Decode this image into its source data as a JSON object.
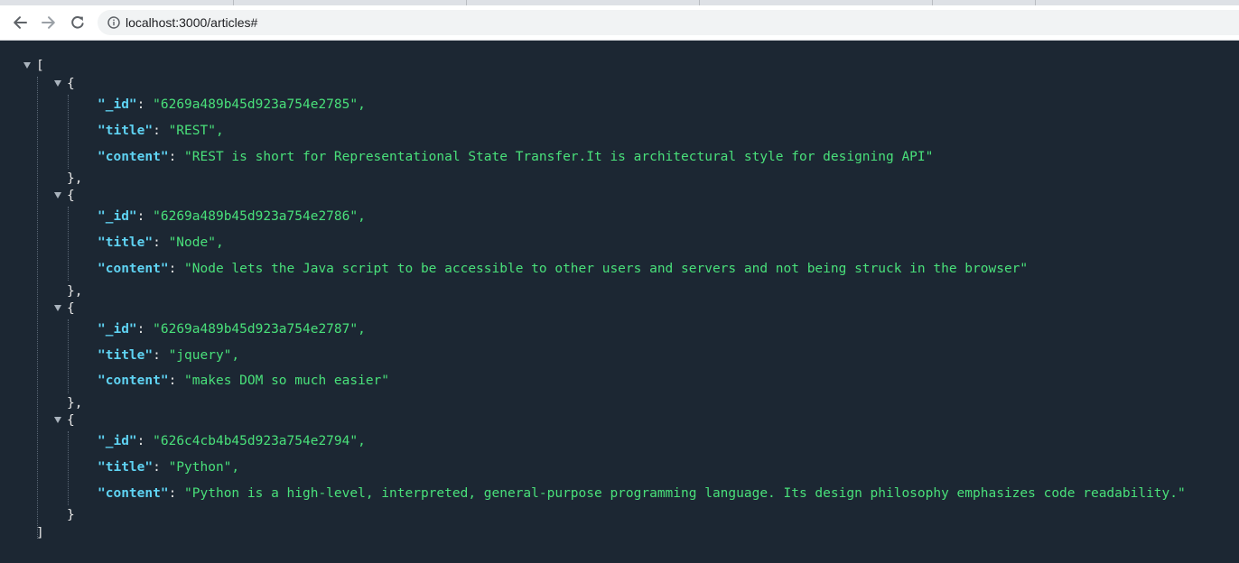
{
  "browser": {
    "url": "localhost:3000/articles#",
    "icons": {
      "back": "arrow-left-icon",
      "forward": "arrow-right-icon",
      "reload": "reload-icon",
      "info": "info-circle-icon"
    }
  },
  "json": {
    "open_bracket": "[",
    "close_bracket": "]",
    "open_brace": "{",
    "close_brace": "}",
    "close_brace_comma": "},",
    "articles": [
      {
        "id_key": "\"_id\"",
        "id": "\"6269a489b45d923a754e2785\",",
        "title_key": "\"title\"",
        "title": "\"REST\",",
        "content_key": "\"content\"",
        "content": "\"REST is short for Representational State Transfer.It is architectural style for designing API\""
      },
      {
        "id_key": "\"_id\"",
        "id": "\"6269a489b45d923a754e2786\",",
        "title_key": "\"title\"",
        "title": "\"Node\",",
        "content_key": "\"content\"",
        "content": "\"Node lets the Java script to be accessible to other users and servers and not being struck in the browser\""
      },
      {
        "id_key": "\"_id\"",
        "id": "\"6269a489b45d923a754e2787\",",
        "title_key": "\"title\"",
        "title": "\"jquery\",",
        "content_key": "\"content\"",
        "content": "\"makes DOM so much easier\""
      },
      {
        "id_key": "\"_id\"",
        "id": "\"626c4cb4b45d923a754e2794\",",
        "title_key": "\"title\"",
        "title": "\"Python\",",
        "content_key": "\"content\"",
        "content": "\"Python is a high-level, interpreted, general-purpose programming language. Its design philosophy emphasizes code readability.\""
      }
    ],
    "colors": {
      "background": "#1c2733",
      "key": "#5fd3f3",
      "string": "#49e07a",
      "punctuation": "#e6e6e6"
    }
  }
}
